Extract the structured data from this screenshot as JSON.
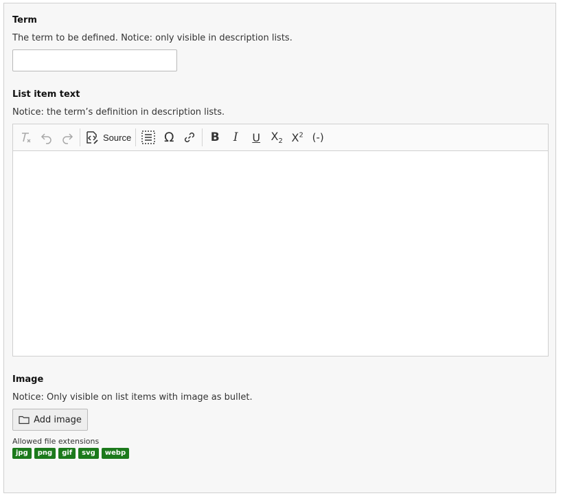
{
  "term": {
    "label": "Term",
    "description": "The term to be defined. Notice: only visible in description lists.",
    "value": "",
    "placeholder": ""
  },
  "list_item": {
    "label": "List item text",
    "description": "Notice: the term’s definition in description lists.",
    "toolbar": {
      "source_label": "Source",
      "bold": "B",
      "italic": "I",
      "underline": "U",
      "subscript": "X",
      "subscript_suffix": "2",
      "superscript": "X",
      "superscript_suffix": "2",
      "soft_hyphen": "(-)",
      "special_char": "Ω"
    }
  },
  "image": {
    "label": "Image",
    "description": "Notice: Only visible on list items with image as bullet.",
    "add_button": "Add image",
    "allowed_label": "Allowed file extensions",
    "extensions": [
      "jpg",
      "png",
      "gif",
      "svg",
      "webp"
    ]
  },
  "colors": {
    "badge": "#1c7a1c",
    "panel_bg": "#f7f7f7",
    "border": "#cfcfcf"
  }
}
